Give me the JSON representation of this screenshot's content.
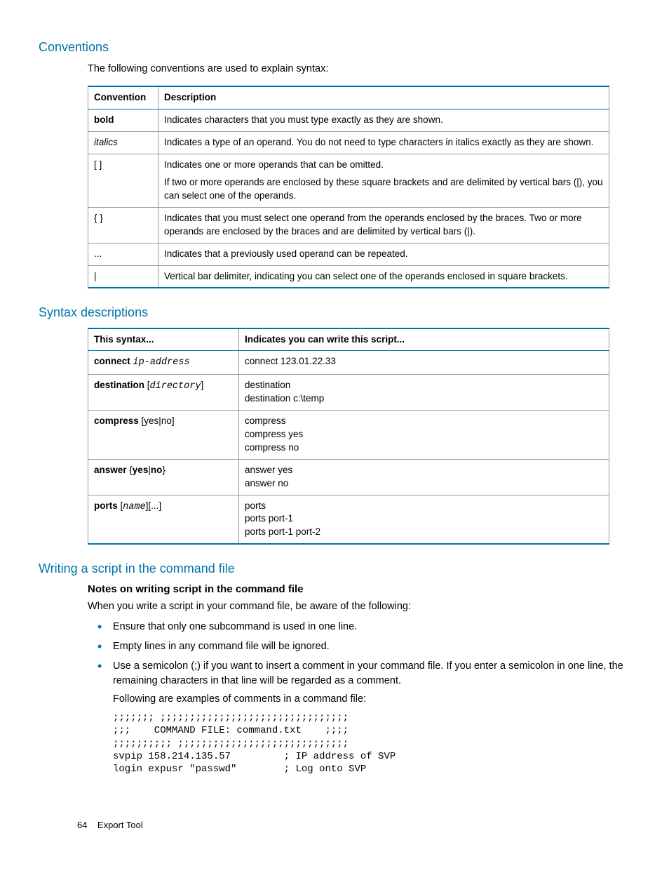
{
  "sections": {
    "conventions": {
      "title": "Conventions",
      "intro": "The following conventions are used to explain syntax:"
    },
    "syntax": {
      "title": "Syntax descriptions"
    },
    "writing": {
      "title": "Writing a script in the command file",
      "subheading": "Notes on writing script in the command file",
      "intro": "When you write a script in your command file, be aware of the following:"
    }
  },
  "conv_table": {
    "head": {
      "c1": "Convention",
      "c2": "Description"
    },
    "rows": [
      {
        "c1": "bold",
        "c2": "Indicates characters that you must type exactly as they are shown."
      },
      {
        "c1": "italics",
        "c2": "Indicates a type of an operand. You do not need to type characters in italics exactly as they are shown."
      },
      {
        "c1": "[ ]",
        "c2a": "Indicates one or more operands that can be omitted.",
        "c2b": "If two or more operands are enclosed by these square brackets and are delimited by vertical bars (|), you can select one of the operands."
      },
      {
        "c1": "{ }",
        "c2": "Indicates that you must select one operand from the operands enclosed by the braces. Two or more operands are enclosed by the braces and are delimited by vertical bars (|)."
      },
      {
        "c1": "...",
        "c2": "Indicates that a previously used operand can be repeated."
      },
      {
        "c1": "|",
        "c2": "Vertical bar delimiter, indicating you can select one of the operands enclosed in square brackets."
      }
    ]
  },
  "syntax_table": {
    "head": {
      "c1": "This syntax...",
      "c2": "Indicates you can write this script..."
    },
    "rows": [
      {
        "s_bold": "connect",
        "s_plain": " ",
        "s_italic": "ip-address",
        "scripts": [
          "connect 123.01.22.33"
        ]
      },
      {
        "s_bold": "destination",
        "s_plain": " [",
        "s_italic": "directory",
        "s_plain2": "]",
        "scripts": [
          "destination",
          "destination c:\\temp"
        ]
      },
      {
        "s_bold": "compress",
        "s_plain": " [yes|no]",
        "scripts": [
          "compress",
          "compress yes",
          "compress no"
        ]
      },
      {
        "s_bold": "answer",
        "s_plain": " {",
        "s_bold2": "yes",
        "s_plain2": "|",
        "s_bold3": "no",
        "s_plain3": "}",
        "scripts": [
          "answer yes",
          "answer no"
        ]
      },
      {
        "s_bold": "ports",
        "s_plain": " [",
        "s_italic": "name",
        "s_plain2": "][...]",
        "scripts": [
          "ports",
          "ports port-1",
          "ports port-1 port-2"
        ]
      }
    ]
  },
  "bullets": [
    "Ensure that only one subcommand is used in one line.",
    "Empty lines in any command file will be ignored.",
    "Use a semicolon (;) if you want to insert a comment in your command file. If you enter a semicolon in one line, the remaining characters in that line will be regarded as a comment."
  ],
  "follow": "Following are examples of comments in a command file:",
  "code": ";;;;;;; ;;;;;;;;;;;;;;;;;;;;;;;;;;;;;;;;\n;;;    COMMAND FILE: command.txt    ;;;;\n;;;;;;;;;; ;;;;;;;;;;;;;;;;;;;;;;;;;;;;;\nsvpip 158.214.135.57         ; IP address of SVP\nlogin expusr \"passwd\"        ; Log onto SVP",
  "footer": {
    "page": "64",
    "label": "Export Tool"
  }
}
